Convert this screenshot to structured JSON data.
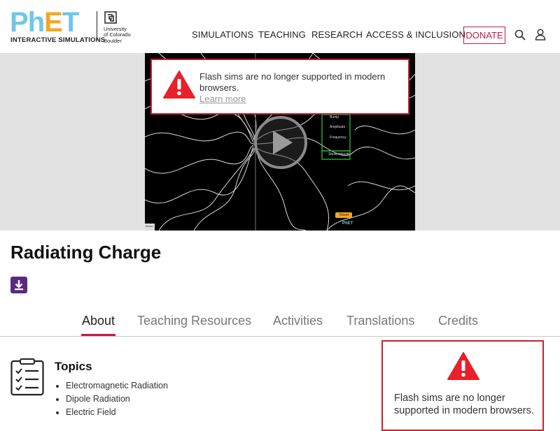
{
  "header": {
    "logo_main": "PhET",
    "logo_sub": "INTERACTIVE SIMULATIONS",
    "university": [
      "University",
      "of Colorado",
      "Boulder"
    ]
  },
  "nav": {
    "items": [
      "SIMULATIONS",
      "TEACHING",
      "RESEARCH",
      "ACCESS & INCLUSION"
    ],
    "donate": "DONATE"
  },
  "icons": {
    "search": "search-icon",
    "user": "user-icon",
    "warning": "warning-icon",
    "play": "play-icon",
    "download": "download-icon",
    "topics": "checklist-icon"
  },
  "flash_alert": {
    "message": "Flash sims are no longer supported in modern browsers.",
    "link": "Learn more"
  },
  "sim_preview": {
    "panel_items": [
      "Bump",
      "Amplitude",
      "Frequency",
      "Show velocity"
    ],
    "reset": "Reset",
    "logo": "PhET",
    "corner": "About"
  },
  "page": {
    "title": "Radiating Charge"
  },
  "tabs": [
    "About",
    "Teaching Resources",
    "Activities",
    "Translations",
    "Credits"
  ],
  "topics": {
    "title": "Topics",
    "items": [
      "Electromagnetic Radiation",
      "Dipole Radiation",
      "Electric Field"
    ]
  },
  "side_alert": {
    "message": "Flash sims are no longer supported in modern browsers."
  },
  "colors": {
    "accent": "#c9184a",
    "alert_border": "#c8202f",
    "warning_red": "#e8202a",
    "download_bg": "#5b2a7e",
    "hero_bg": "#e2e2e2"
  }
}
